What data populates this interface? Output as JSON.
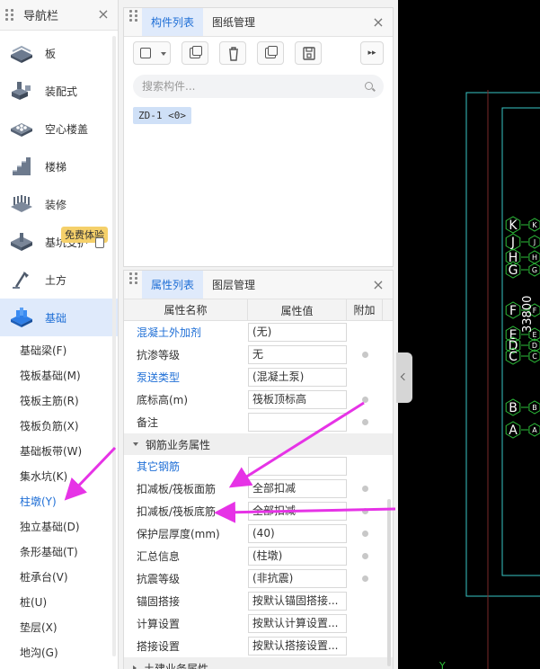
{
  "nav": {
    "title": "导航栏",
    "categories": [
      {
        "label": "板"
      },
      {
        "label": "装配式"
      },
      {
        "label": "空心楼盖"
      },
      {
        "label": "楼梯"
      },
      {
        "label": "装修"
      },
      {
        "label": "基坑支护",
        "badge": "免费体验"
      },
      {
        "label": "土方"
      },
      {
        "label": "基础"
      }
    ],
    "items": [
      "基础梁(F)",
      "筏板基础(M)",
      "筏板主筋(R)",
      "筏板负筋(X)",
      "基础板带(W)",
      "集水坑(K)",
      "柱墩(Y)",
      "独立基础(D)",
      "条形基础(T)",
      "桩承台(V)",
      "桩(U)",
      "垫层(X)",
      "地沟(G)"
    ]
  },
  "components": {
    "tabs": [
      "构件列表",
      "图纸管理"
    ],
    "search_placeholder": "搜索构件...",
    "items": [
      "ZD-1 <0>"
    ]
  },
  "properties": {
    "tabs": [
      "属性列表",
      "图层管理"
    ],
    "headers": [
      "属性名称",
      "属性值",
      "附加"
    ],
    "rows": [
      {
        "name": "混凝土外加剂",
        "value": "(无)",
        "blue": true,
        "dot": false
      },
      {
        "name": "抗渗等级",
        "value": "无",
        "blue": false,
        "dot": true
      },
      {
        "name": "泵送类型",
        "value": "(混凝土泵)",
        "blue": true,
        "dot": false
      },
      {
        "name": "底标高(m)",
        "value": "筏板顶标高",
        "blue": false,
        "dot": true
      },
      {
        "name": "备注",
        "value": "",
        "blue": false,
        "dot": true
      }
    ],
    "group1": "钢筋业务属性",
    "rows2": [
      {
        "name": "其它钢筋",
        "value": "",
        "blue": true,
        "dot": false
      },
      {
        "name": "扣减板/筏板面筋",
        "value": "全部扣减",
        "blue": false,
        "dot": true
      },
      {
        "name": "扣减板/筏板底筋",
        "value": "全部扣减",
        "blue": false,
        "dot": true
      },
      {
        "name": "保护层厚度(mm)",
        "value": "(40)",
        "blue": false,
        "dot": true
      },
      {
        "name": "汇总信息",
        "value": "(柱墩)",
        "blue": false,
        "dot": true
      },
      {
        "name": "抗震等级",
        "value": "(非抗震)",
        "blue": false,
        "dot": true
      },
      {
        "name": "锚固搭接",
        "value": "按默认锚固搭接...",
        "blue": false,
        "dot": false
      },
      {
        "name": "计算设置",
        "value": "按默认计算设置...",
        "blue": false,
        "dot": false
      },
      {
        "name": "搭接设置",
        "value": "按默认搭接设置...",
        "blue": false,
        "dot": false
      }
    ],
    "group2": "土建业务属性"
  },
  "canvas": {
    "axes": [
      {
        "label": "K",
        "small": "K"
      },
      {
        "label": "J",
        "small": "J"
      },
      {
        "label": "H",
        "small": "H"
      },
      {
        "label": "G",
        "small": "G"
      },
      {
        "label": "F",
        "small": "F"
      },
      {
        "label": "E",
        "small": "E"
      },
      {
        "label": "D",
        "small": "D"
      },
      {
        "label": "C",
        "small": "C"
      },
      {
        "label": "B",
        "small": "B"
      },
      {
        "label": "A",
        "small": "A"
      }
    ],
    "dimension_text": "33800",
    "y_axis_label": "Y",
    "colors": {
      "grid": "#2dbf3a",
      "outline": "#39c6c6",
      "label": "#ffffff"
    }
  },
  "colors": {
    "accent": "#1f6fd6",
    "arrow": "#e633e6",
    "selected_bg": "#dfeafb"
  }
}
